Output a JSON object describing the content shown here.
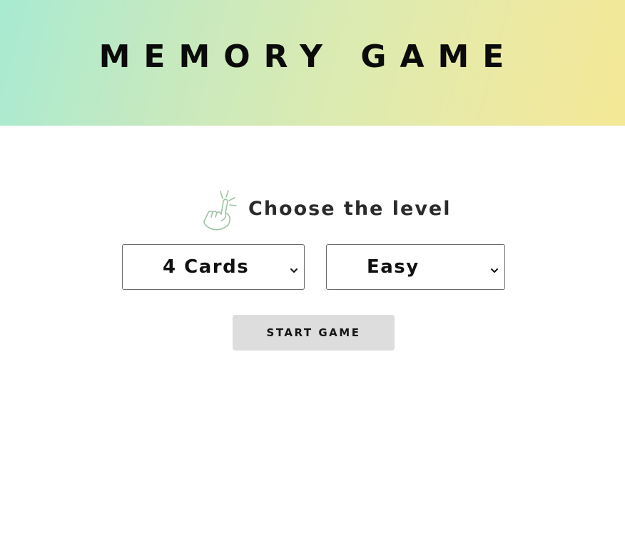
{
  "header": {
    "title": "MEMORY GAME"
  },
  "level": {
    "label": "Choose the level",
    "icon": "pointing-hand-icon"
  },
  "selects": {
    "cards": {
      "value": "4 Cards",
      "icon": "chevron-down-icon"
    },
    "difficulty": {
      "value": "Easy",
      "icon": "chevron-down-icon"
    }
  },
  "actions": {
    "start_label": "START GAME"
  },
  "colors": {
    "header_gradient_start": "#a8ead2",
    "header_gradient_end": "#f4e895",
    "button_bg": "#dddddd",
    "icon_stroke": "#9dc3a3"
  }
}
